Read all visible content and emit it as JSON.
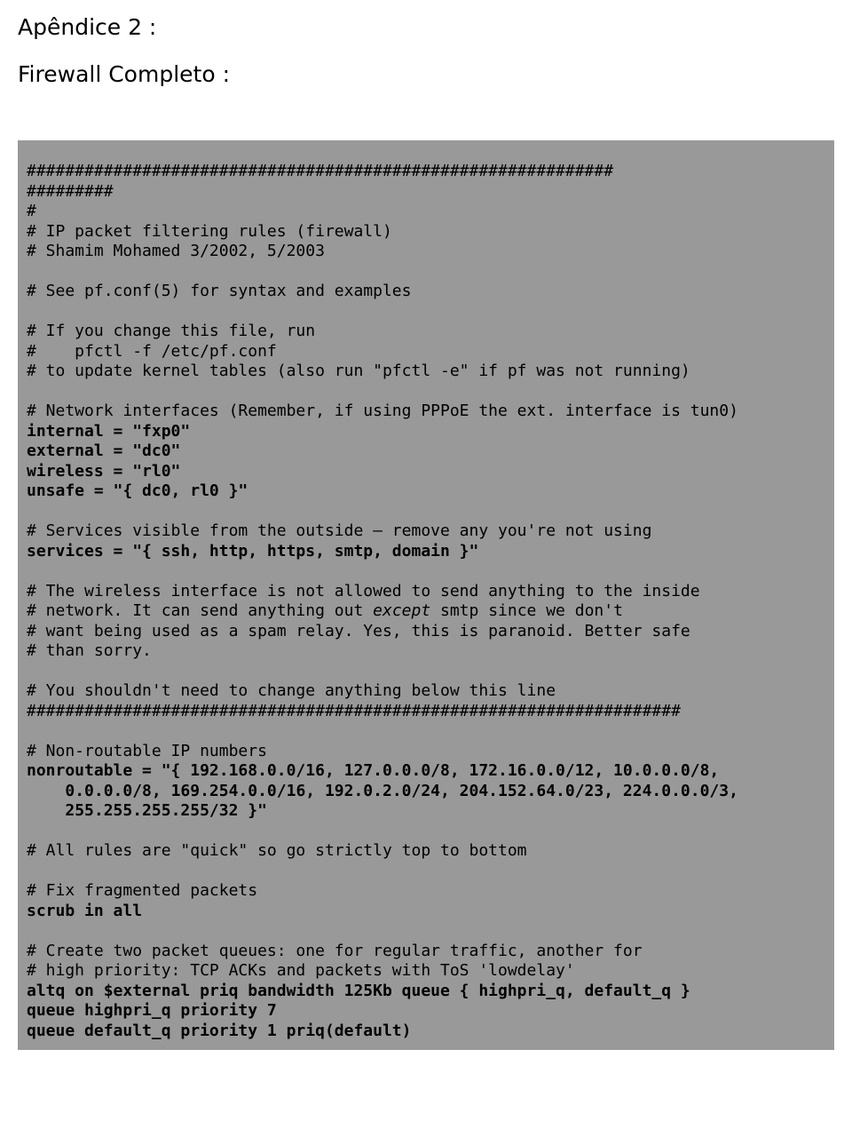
{
  "headings": {
    "title": "Apêndice 2 :",
    "subtitle": "Firewall Completo :"
  },
  "code": {
    "l01": "#############################################################",
    "l02": "#########",
    "l03": "#",
    "l04": "# IP packet filtering rules (firewall)",
    "l05": "# Shamim Mohamed 3/2002, 5/2003",
    "l06": "# See pf.conf(5) for syntax and examples",
    "l07": "# If you change this file, run",
    "l08": "#    pfctl -f /etc/pf.conf",
    "l09": "# to update kernel tables (also run \"pfctl -e\" if pf was not running)",
    "l10": "# Network interfaces (Remember, if using PPPoE the ext. interface is tun0)",
    "l11": "internal = \"fxp0\"",
    "l12": "external = \"dc0\"",
    "l13": "wireless = \"rl0\"",
    "l14": "unsafe = \"{ dc0, rl0 }\"",
    "l15": "# Services visible from the outside — remove any you're not using",
    "l16": "services = \"{ ssh, http, https, smtp, domain }\"",
    "l17": "# The wireless interface is not allowed to send anything to the inside",
    "l18a": "# network. It can send anything out ",
    "l18b": "except",
    "l18c": " smtp since we don't",
    "l19": "# want being used as a spam relay. Yes, this is paranoid. Better safe",
    "l20": "# than sorry.",
    "l21": "# You shouldn't need to change anything below this line",
    "l22": "####################################################################",
    "l23": "# Non-routable IP numbers",
    "l24": "nonroutable = \"{ 192.168.0.0/16, 127.0.0.0/8, 172.16.0.0/12, 10.0.0.0/8,",
    "l25": "    0.0.0.0/8, 169.254.0.0/16, 192.0.2.0/24, 204.152.64.0/23, 224.0.0.0/3,",
    "l26": "    255.255.255.255/32 }\"",
    "l27": "# All rules are \"quick\" so go strictly top to bottom",
    "l28": "# Fix fragmented packets",
    "l29": "scrub in all",
    "l30": "# Create two packet queues: one for regular traffic, another for",
    "l31": "# high priority: TCP ACKs and packets with ToS 'lowdelay'",
    "l32": "altq on $external priq bandwidth 125Kb queue { highpri_q, default_q }",
    "l33": "queue highpri_q priority 7",
    "l34": "queue default_q priority 1 priq(default)"
  }
}
